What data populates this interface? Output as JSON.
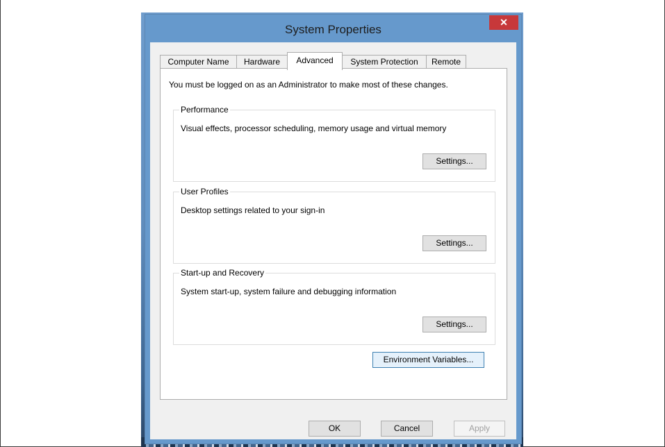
{
  "window": {
    "title": "System Properties",
    "close_glyph": "✕"
  },
  "tabs": [
    {
      "label": "Computer Name",
      "active": false
    },
    {
      "label": "Hardware",
      "active": false
    },
    {
      "label": "Advanced",
      "active": true
    },
    {
      "label": "System Protection",
      "active": false
    },
    {
      "label": "Remote",
      "active": false
    }
  ],
  "notice": "You must be logged on as an Administrator to make most of these changes.",
  "groups": {
    "performance": {
      "title": "Performance",
      "description": "Visual effects, processor scheduling, memory usage and virtual memory",
      "button": "Settings..."
    },
    "user_profiles": {
      "title": "User Profiles",
      "description": "Desktop settings related to your sign-in",
      "button": "Settings..."
    },
    "startup_recovery": {
      "title": "Start-up and Recovery",
      "description": "System start-up, system failure and debugging information",
      "button": "Settings..."
    }
  },
  "env_button": "Environment Variables...",
  "footer": {
    "ok": "OK",
    "cancel": "Cancel",
    "apply": "Apply"
  },
  "colors": {
    "titlebar": "#6699cc",
    "close": "#c7383a",
    "focus_border": "#3c7fb1"
  }
}
